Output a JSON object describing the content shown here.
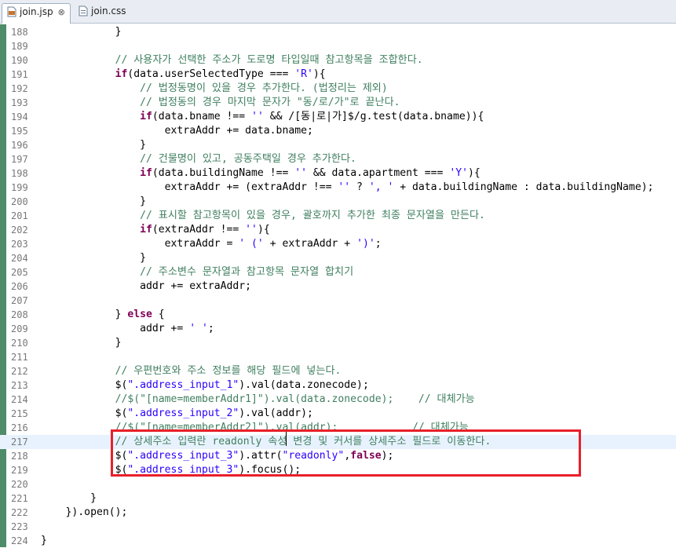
{
  "tabs": [
    {
      "label": "join.jsp",
      "active": true,
      "close": "⊗"
    },
    {
      "label": "join.css",
      "active": false
    }
  ],
  "colors": {
    "highlight_box": "#e8202a",
    "comment": "#3f7f5f",
    "string": "#2a00ff",
    "current_line": "#e8f2fe"
  },
  "lines": [
    {
      "num": "188",
      "text": "            }"
    },
    {
      "num": "189",
      "text": ""
    },
    {
      "num": "190",
      "text": "            // 사용자가 선택한 주소가 도로명 타입일때 참고항목을 조합한다."
    },
    {
      "num": "191",
      "text": "            if(data.userSelectedType === 'R'){"
    },
    {
      "num": "192",
      "text": "                // 법정동명이 있을 경우 추가한다. (법정리는 제외)"
    },
    {
      "num": "193",
      "text": "                // 법정동의 경우 마지막 문자가 \"동/로/가\"로 끝난다."
    },
    {
      "num": "194",
      "text": "                if(data.bname !== '' && /[동|로|가]$/g.test(data.bname)){"
    },
    {
      "num": "195",
      "text": "                    extraAddr += data.bname;"
    },
    {
      "num": "196",
      "text": "                }"
    },
    {
      "num": "197",
      "text": "                // 건물명이 있고, 공동주택일 경우 추가한다."
    },
    {
      "num": "198",
      "text": "                if(data.buildingName !== '' && data.apartment === 'Y'){"
    },
    {
      "num": "199",
      "text": "                    extraAddr += (extraAddr !== '' ? ', ' + data.buildingName : data.buildingName);"
    },
    {
      "num": "200",
      "text": "                }"
    },
    {
      "num": "201",
      "text": "                // 표시할 참고항목이 있을 경우, 괄호까지 추가한 최종 문자열을 만든다."
    },
    {
      "num": "202",
      "text": "                if(extraAddr !== ''){"
    },
    {
      "num": "203",
      "text": "                    extraAddr = ' (' + extraAddr + ')';"
    },
    {
      "num": "204",
      "text": "                }"
    },
    {
      "num": "205",
      "text": "                // 주소변수 문자열과 참고항목 문자열 합치기"
    },
    {
      "num": "206",
      "text": "                addr += extraAddr;"
    },
    {
      "num": "207",
      "text": ""
    },
    {
      "num": "208",
      "text": "            } else {"
    },
    {
      "num": "209",
      "text": "                addr += ' ';"
    },
    {
      "num": "210",
      "text": "            }"
    },
    {
      "num": "211",
      "text": ""
    },
    {
      "num": "212",
      "text": "            // 우편번호와 주소 정보를 해당 필드에 넣는다."
    },
    {
      "num": "213",
      "text": "            $(\".address_input_1\").val(data.zonecode);"
    },
    {
      "num": "214",
      "text": "            //$(\"[name=memberAddr1]\").val(data.zonecode);    // 대체가능"
    },
    {
      "num": "215",
      "text": "            $(\".address_input_2\").val(addr);"
    },
    {
      "num": "216",
      "text": "            //$(\"[name=memberAddr2]\").val(addr);            // 대체가능"
    },
    {
      "num": "217",
      "text": "            // 상세주소 입력란 readonly 속성 변경 및 커서를 상세주소 필드로 이동한다.",
      "current": true
    },
    {
      "num": "218",
      "text": "            $(\".address_input_3\").attr(\"readonly\",false);"
    },
    {
      "num": "219",
      "text": "            $(\".address_input_3\").focus();"
    },
    {
      "num": "220",
      "text": ""
    },
    {
      "num": "221",
      "text": "        }"
    },
    {
      "num": "222",
      "text": "    }).open();"
    },
    {
      "num": "223",
      "text": ""
    },
    {
      "num": "224",
      "text": "}"
    }
  ]
}
